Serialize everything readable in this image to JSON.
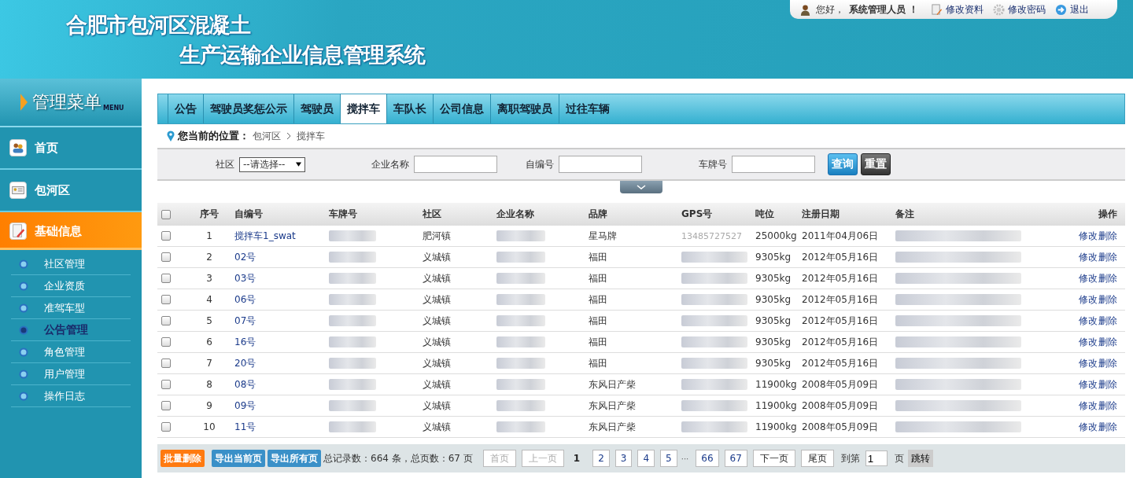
{
  "header": {
    "title_line1": "合肥市包河区混凝土",
    "title_line2": "生产运输企业信息管理系统"
  },
  "user_bar": {
    "greeting": "您好，",
    "user": "系统管理人员 ！",
    "links": [
      {
        "label": "修改资料",
        "kind": "edit"
      },
      {
        "label": "修改密码",
        "kind": "gear"
      },
      {
        "label": "退出",
        "kind": "exit"
      }
    ]
  },
  "sidebar": {
    "title": "管理菜单",
    "title_sub": "MENU",
    "items": [
      {
        "label": "首页",
        "kind": "people",
        "selected": false,
        "expanded": false
      },
      {
        "label": "包河区",
        "kind": "card",
        "selected": false,
        "expanded": false
      },
      {
        "label": "基础信息",
        "kind": "note",
        "selected": true,
        "expanded": true,
        "children": [
          {
            "label": "社区管理",
            "selected": false
          },
          {
            "label": "企业资质",
            "selected": false
          },
          {
            "label": "准驾车型",
            "selected": false
          },
          {
            "label": "公告管理",
            "selected": true
          },
          {
            "label": "角色管理",
            "selected": false
          },
          {
            "label": "用户管理",
            "selected": false
          },
          {
            "label": "操作日志",
            "selected": false
          }
        ]
      }
    ]
  },
  "tabs": [
    {
      "label": "公告",
      "selected": false
    },
    {
      "label": "驾驶员奖惩公示",
      "selected": false
    },
    {
      "label": "驾驶员",
      "selected": false
    },
    {
      "label": "搅拌车",
      "selected": true
    },
    {
      "label": "车队长",
      "selected": false
    },
    {
      "label": "公司信息",
      "selected": false
    },
    {
      "label": "离职驾驶员",
      "selected": false
    },
    {
      "label": "过往车辆",
      "selected": false
    }
  ],
  "breadcrumb": {
    "label": "您当前的位置：",
    "path": [
      "包河区",
      "搅拌车"
    ]
  },
  "filters": [
    {
      "label": "社区",
      "kind": "select",
      "value": "--请选择--"
    },
    {
      "label": "企业名称",
      "kind": "text"
    },
    {
      "label": "自编号",
      "kind": "text"
    },
    {
      "label": "车牌号",
      "kind": "text"
    }
  ],
  "filter_buttons": [
    {
      "label": "查询",
      "kind": "primary"
    },
    {
      "label": "重置",
      "kind": "secondary"
    }
  ],
  "table": {
    "all_checked": false,
    "columns": [
      "序号",
      "自编号",
      "车牌号",
      "社区",
      "企业名称",
      "品牌",
      "GPS号",
      "吨位",
      "注册日期",
      "备注",
      "操作"
    ],
    "rows": [
      {
        "no": "1",
        "code": "搅拌车1_swat",
        "community": "肥河镇",
        "brand": "星马牌",
        "gps": "13485727527",
        "tonnage": "25000kg",
        "date": "2011年04月06日",
        "actions": [
          "修改",
          "删除"
        ],
        "checked": false
      },
      {
        "no": "2",
        "code": "02号",
        "community": "义城镇",
        "brand": "福田",
        "tonnage": "9305kg",
        "date": "2012年05月16日",
        "actions": [
          "修改",
          "删除"
        ],
        "checked": false
      },
      {
        "no": "3",
        "code": "03号",
        "community": "义城镇",
        "brand": "福田",
        "tonnage": "9305kg",
        "date": "2012年05月16日",
        "actions": [
          "修改",
          "删除"
        ],
        "checked": false
      },
      {
        "no": "4",
        "code": "06号",
        "community": "义城镇",
        "brand": "福田",
        "tonnage": "9305kg",
        "date": "2012年05月16日",
        "actions": [
          "修改",
          "删除"
        ],
        "checked": false
      },
      {
        "no": "5",
        "code": "07号",
        "community": "义城镇",
        "brand": "福田",
        "tonnage": "9305kg",
        "date": "2012年05月16日",
        "actions": [
          "修改",
          "删除"
        ],
        "checked": false
      },
      {
        "no": "6",
        "code": "16号",
        "community": "义城镇",
        "brand": "福田",
        "tonnage": "9305kg",
        "date": "2012年05月16日",
        "actions": [
          "修改",
          "删除"
        ],
        "checked": false
      },
      {
        "no": "7",
        "code": "20号",
        "community": "义城镇",
        "brand": "福田",
        "tonnage": "9305kg",
        "date": "2012年05月16日",
        "actions": [
          "修改",
          "删除"
        ],
        "checked": false
      },
      {
        "no": "8",
        "code": "08号",
        "community": "义城镇",
        "brand": "东风日产柴",
        "tonnage": "11900kg",
        "date": "2008年05月09日",
        "actions": [
          "修改",
          "删除"
        ],
        "checked": false
      },
      {
        "no": "9",
        "code": "09号",
        "community": "义城镇",
        "brand": "东风日产柴",
        "tonnage": "11900kg",
        "date": "2008年05月09日",
        "actions": [
          "修改",
          "删除"
        ],
        "checked": false
      },
      {
        "no": "10",
        "code": "11号",
        "community": "义城镇",
        "brand": "东风日产柴",
        "tonnage": "11900kg",
        "date": "2008年05月09日",
        "actions": [
          "修改",
          "删除"
        ],
        "checked": false
      }
    ]
  },
  "footer": {
    "buttons": [
      {
        "label": "批量删除",
        "kind": "danger"
      },
      {
        "label": "导出当前页",
        "kind": "export"
      },
      {
        "label": "导出所有页",
        "kind": "export"
      }
    ],
    "summary": "总记录数：664 条，总页数：67 页",
    "pages": [
      {
        "label": "首页",
        "kind": "nav",
        "selected": false,
        "disabled": true
      },
      {
        "label": "上一页",
        "kind": "nav",
        "selected": false,
        "disabled": true
      },
      {
        "label": "1",
        "kind": "page",
        "selected": true,
        "disabled": false
      },
      {
        "label": "2",
        "kind": "page",
        "selected": false,
        "disabled": false
      },
      {
        "label": "3",
        "kind": "page",
        "selected": false,
        "disabled": false
      },
      {
        "label": "4",
        "kind": "page",
        "selected": false,
        "disabled": false
      },
      {
        "label": "5",
        "kind": "page",
        "selected": false,
        "disabled": false
      },
      {
        "label": "···",
        "kind": "ellipsis",
        "selected": false,
        "disabled": false
      },
      {
        "label": "66",
        "kind": "page",
        "selected": false,
        "disabled": false
      },
      {
        "label": "67",
        "kind": "page",
        "selected": false,
        "disabled": false
      },
      {
        "label": "下一页",
        "kind": "nav",
        "selected": false,
        "disabled": false
      },
      {
        "label": "尾页",
        "kind": "nav",
        "selected": false,
        "disabled": false
      }
    ],
    "goto_label": "到第",
    "goto_value": "1",
    "goto_unit": "页",
    "goto_button": "跳转"
  }
}
